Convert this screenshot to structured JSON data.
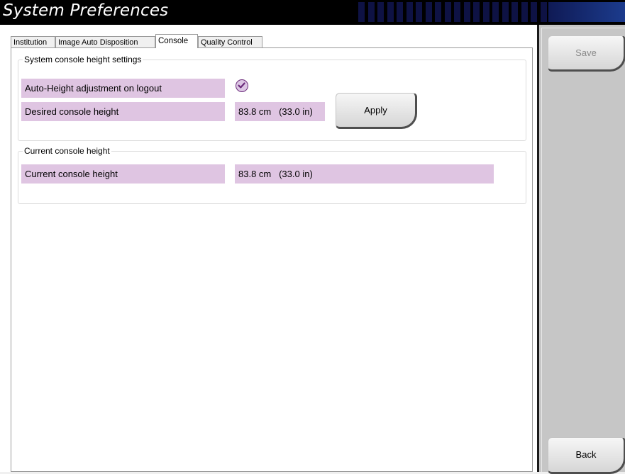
{
  "window": {
    "title": "System Preferences"
  },
  "tabs": [
    "Institution",
    "Image Auto Disposition",
    "Console",
    "Quality Control"
  ],
  "active_tab": "Console",
  "system_console_group": {
    "legend": "System console height settings",
    "auto_height_label": "Auto-Height adjustment on logout",
    "auto_height_checked": true,
    "desired_label": "Desired console height",
    "desired_value": "83.8 cm   (33.0 in)",
    "apply_label": "Apply"
  },
  "current_console_group": {
    "legend": "Current console height",
    "current_label": "Current console height",
    "current_value": "83.8 cm   (33.0 in)"
  },
  "sidebar": {
    "save_label": "Save",
    "back_label": "Back"
  },
  "colors": {
    "field_bg": "#dfc5e2",
    "check_accent": "#6a2a7a",
    "titlebar": "#000000"
  }
}
